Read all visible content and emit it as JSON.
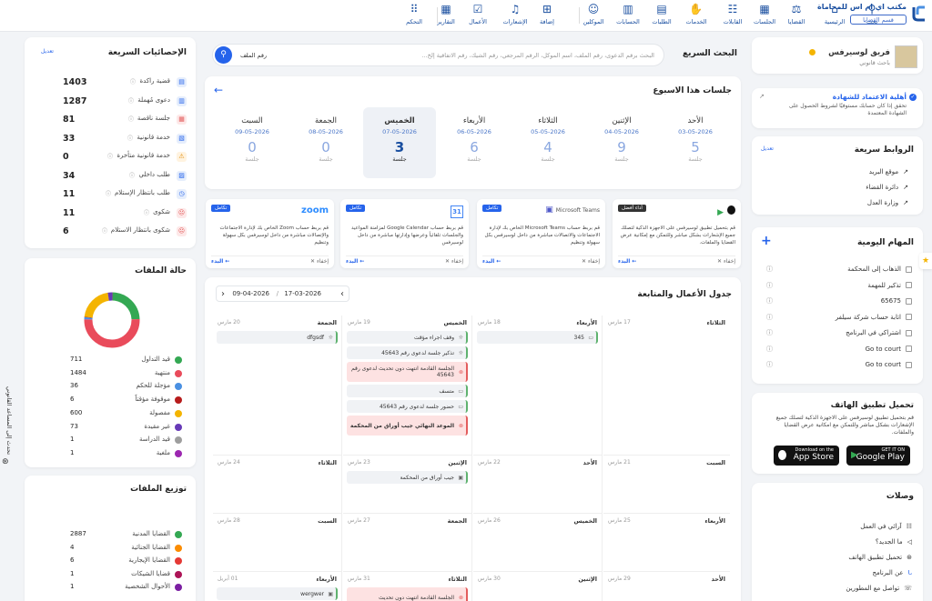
{
  "header": {
    "office": "مكتب اي ام اس للمحاماة",
    "dept": "قسم القضايا",
    "nav": [
      "بحث",
      "الرئيسية",
      "القضايا",
      "الجلسات",
      "القابلات",
      "الخدمات",
      "الطلبات",
      "الحسابات",
      "الموكلين",
      "إضافة",
      "الإشعارات",
      "الأعمال",
      "التقارير",
      "التحكم"
    ]
  },
  "profile": {
    "name": "فريق لوسيرفس",
    "role": "باحث قانوني"
  },
  "cert": {
    "title": "أهلية الاعتماد للشهادة",
    "desc": "تحقق إذا كان حسابك مستوفيًا لشروط الحصول على الشهادة المعتمدة"
  },
  "quick_links": {
    "title": "الروابط سريعة",
    "edit": "تعديل",
    "items": [
      "موقع البريد",
      "دائرة القضاء",
      "وزارة العدل"
    ]
  },
  "tasks": {
    "title": "المهام اليومية",
    "add": "+",
    "items": [
      "الذهاب إلى المحكمة",
      "تذكير للمهمة",
      "65675",
      "اتابة حساب شركة سيلفر",
      "اشتراكي في البرنامج",
      "Go to court",
      "Go to court"
    ]
  },
  "app": {
    "title": "تحميل تطبيق الهاتف",
    "desc": "قم بتحميل تطبيق لوسيرفس على الاجهزة الذكية لتصلك جميع الإشعارات بشكل مباشر وللتمكن مع امكانية عرض القضايا والملفات.",
    "appstore_small": "Download on the",
    "appstore": "App Store",
    "gplay_small": "GET IT ON",
    "gplay": "Google Play"
  },
  "links": {
    "title": "وصلات",
    "items": [
      "آرائي في العمل",
      "ما الجديد؟",
      "تحميل تطبيق الهاتف",
      "عن البرنامج",
      "تواصل مع المطورين"
    ]
  },
  "search": {
    "title": "البحث السريع",
    "placeholder": "البحث برقم الدعوى، رقم الملف، اسم الموكل، الرقم المرجعي، رقم الشيك، رقم الاتفاقية إلخ...",
    "select": "رقم الملف"
  },
  "week": {
    "title": "جلسات هذا الاسبوع",
    "unit": "جلسة",
    "days": [
      {
        "name": "الأحد",
        "date": "03-05-2026",
        "count": "5"
      },
      {
        "name": "الإثنين",
        "date": "04-05-2026",
        "count": "9"
      },
      {
        "name": "الثلاثاء",
        "date": "05-05-2026",
        "count": "4"
      },
      {
        "name": "الأربعاء",
        "date": "06-05-2026",
        "count": "6"
      },
      {
        "name": "الخميس",
        "date": "07-05-2026",
        "count": "3"
      },
      {
        "name": "الجمعة",
        "date": "08-05-2026",
        "count": "0"
      },
      {
        "name": "السبت",
        "date": "09-05-2026",
        "count": "0"
      }
    ]
  },
  "integrations": [
    {
      "brand": "Apple + Google Play",
      "badge": "أداء أفضل",
      "text": "قم بتحميل تطبيق لوسيرفس على الاجهزة الذكية لتصلك جميع الإشعارات بشكل مباشر وللتمكن مع إمكانية عرض القضايا والملفات.",
      "go": "البدء",
      "skip": "إخفاء"
    },
    {
      "brand": "Microsoft Teams",
      "badge": "تكامل",
      "text": "قم بربط حساب Microsoft Teams الخاص بك لإدارة الاجتماعات والاتصالات مباشرة من داخل لوسيرفس بكل سهولة وتنظيم",
      "go": "البدء",
      "skip": "إخفاء"
    },
    {
      "brand": "31",
      "badge": "تكامل",
      "text": "قم بربط حساب Google Calendar لمزامنة المواعيد والجلسات تلقائياً وعرضها وإدارتها مباشرة من داخل لوسيرفس",
      "go": "البدء",
      "skip": "إخفاء"
    },
    {
      "brand": "zoom",
      "badge": "تكامل",
      "text": "قم بربط حساب Zoom الخاص بك لإدارة الاجتماعات والإتصالات مباشرة من داخل لوسيرفس بكل سهولة وتنظيم",
      "go": "البدء",
      "skip": "إخفاء"
    }
  ],
  "schedule": {
    "title": "جدول الأعمال والمتابعة",
    "from": "17-03-2026",
    "to": "09-04-2026",
    "sep": "/",
    "weeks": [
      [
        {
          "n": "الثلاثاء",
          "d": "17 مارس",
          "ev": []
        },
        {
          "n": "الأربعاء",
          "d": "18 مارس",
          "ev": [
            {
              "t": "345",
              "i": "▭",
              "red": false
            }
          ]
        },
        {
          "n": "الخميس",
          "d": "19 مارس",
          "ev": [
            {
              "t": "وقف اجراء مؤقت",
              "i": "☼",
              "red": false
            },
            {
              "t": "تذكير جلسة لدعوى رقم 45643",
              "i": "☼",
              "red": false
            },
            {
              "t": "الجلسة القادمة انتهت دون تحديث لدعوى رقم 45643",
              "i": "⊗",
              "red": true
            },
            {
              "t": "متسف",
              "i": "▭",
              "red": false
            },
            {
              "t": "حضور جلسة لدعوى رقم 45643",
              "i": "▭",
              "red": false
            },
            {
              "t": "الموعد النهائي جيب أوراق من المحكمة",
              "i": "⊗",
              "red": true
            }
          ]
        },
        {
          "n": "الجمعة",
          "d": "20 مارس",
          "ev": [
            {
              "t": "dfgsdf",
              "i": "☼",
              "red": false
            }
          ]
        }
      ],
      [
        {
          "n": "السبت",
          "d": "21 مارس",
          "ev": []
        },
        {
          "n": "الأحد",
          "d": "22 مارس",
          "ev": []
        },
        {
          "n": "الإثنين",
          "d": "23 مارس",
          "ev": [
            {
              "t": "جيب أوراق من المحكمة",
              "i": "▣",
              "red": false
            }
          ]
        },
        {
          "n": "الثلاثاء",
          "d": "24 مارس",
          "ev": []
        }
      ],
      [
        {
          "n": "الأربعاء",
          "d": "25 مارس",
          "ev": []
        },
        {
          "n": "الخميس",
          "d": "26 مارس",
          "ev": []
        },
        {
          "n": "الجمعة",
          "d": "27 مارس",
          "ev": []
        },
        {
          "n": "السبت",
          "d": "28 مارس",
          "ev": []
        }
      ],
      [
        {
          "n": "الأحد",
          "d": "29 مارس",
          "ev": []
        },
        {
          "n": "الإثنين",
          "d": "30 مارس",
          "ev": []
        },
        {
          "n": "الثلاثاء",
          "d": "31 مارس",
          "ev": [
            {
              "t": "الجلسة القادمة انتهت دون تحديث",
              "i": "⊗",
              "red": true
            }
          ]
        },
        {
          "n": "الأربعاء",
          "d": "01 أبريل",
          "ev": [
            {
              "t": "wergwer",
              "i": "▣",
              "red": false
            }
          ]
        }
      ]
    ]
  },
  "stats": {
    "title": "الإحصائيات السريعة",
    "edit": "تعديل",
    "items": [
      {
        "label": "قضية راكدة",
        "value": "1403",
        "icon": "archive-icon",
        "color": "#2563eb",
        "bg": "#e6eefc",
        "g": "▤"
      },
      {
        "label": "دعوى مُهملة",
        "value": "1287",
        "icon": "briefcase-icon",
        "color": "#2563eb",
        "bg": "#e6eefc",
        "g": "▥"
      },
      {
        "label": "جلسة ناقصة",
        "value": "81",
        "icon": "calendar-icon",
        "color": "#e35d5d",
        "bg": "#fde8e8",
        "g": "▦"
      },
      {
        "label": "خدمة قانونية",
        "value": "33",
        "icon": "doc-icon",
        "color": "#2563eb",
        "bg": "#e6eefc",
        "g": "▧"
      },
      {
        "label": "خدمة قانونية متأخرة",
        "value": "0",
        "icon": "warning-icon",
        "color": "#e08a00",
        "bg": "#fff3e0",
        "g": "⚠"
      },
      {
        "label": "طلب داخلي",
        "value": "34",
        "icon": "request-icon",
        "color": "#2563eb",
        "bg": "#e6eefc",
        "g": "▨"
      },
      {
        "label": "طلب بانتظار الإستلام",
        "value": "11",
        "icon": "clock-icon",
        "color": "#2563eb",
        "bg": "#e6eefc",
        "g": "◷"
      },
      {
        "label": "شكوى",
        "value": "11",
        "icon": "complaint-icon",
        "color": "#e35d5d",
        "bg": "#fde8e8",
        "g": "☹"
      },
      {
        "label": "شكوى بانتظار الاستلام",
        "value": "6",
        "icon": "complaint-wait-icon",
        "color": "#e35d5d",
        "bg": "#fde8e8",
        "g": "☹"
      }
    ]
  },
  "file_status": {
    "title": "حالة الملفات",
    "items": [
      {
        "label": "قيد التداول",
        "value": "711",
        "color": "#34a853"
      },
      {
        "label": "منتهية",
        "value": "1484",
        "color": "#e94b5b"
      },
      {
        "label": "مؤجلة للحكم",
        "value": "36",
        "color": "#4a90e2"
      },
      {
        "label": "موقوفة مؤقتاً",
        "value": "6",
        "color": "#b71c1c"
      },
      {
        "label": "مفصولة",
        "value": "600",
        "color": "#f4b400"
      },
      {
        "label": "غير مقيدة",
        "value": "73",
        "color": "#673ab7"
      },
      {
        "label": "قيد الدراسة",
        "value": "1",
        "color": "#9e9e9e"
      },
      {
        "label": "ملغية",
        "value": "1",
        "color": "#9c27b0"
      }
    ]
  },
  "distribution": {
    "title": "توزيع الملفات",
    "items": [
      {
        "label": "القضايا المدنية",
        "value": "2887",
        "color": "#34a853"
      },
      {
        "label": "القضايا الجنائية",
        "value": "4",
        "color": "#fb8c00"
      },
      {
        "label": "القضايا الإيجارية",
        "value": "6",
        "color": "#e53935"
      },
      {
        "label": "قضايا الشيكات",
        "value": "1",
        "color": "#ad1457"
      },
      {
        "label": "الأحوال الشخصية",
        "value": "1",
        "color": "#7b1fa2"
      }
    ]
  },
  "side_tab": "تحدث إلى المساعد القانوني"
}
